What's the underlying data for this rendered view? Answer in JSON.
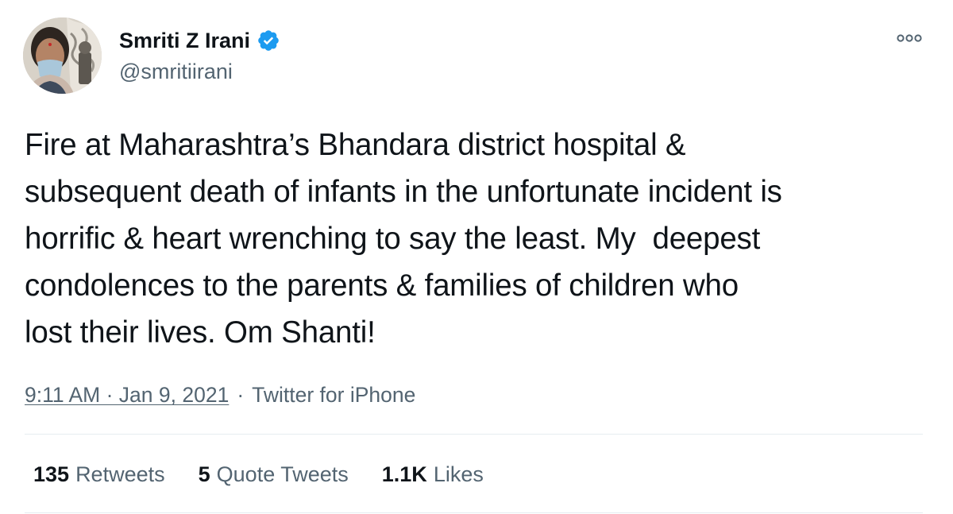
{
  "author": {
    "display_name": "Smriti Z Irani",
    "handle": "@smritiirani",
    "verified": true,
    "avatar_icon": "profile-photo"
  },
  "tweet": {
    "text": "Fire at Maharashtra’s Bhandara district hospital &\nsubsequent death of infants in the unfortunate incident is\nhorrific & heart wrenching to say the least. My  deepest\ncondolences to the parents & families of children who\nlost their lives. Om Shanti!",
    "timestamp": "9:11 AM · Jan 9, 2021",
    "separator": "·",
    "source": "Twitter for iPhone"
  },
  "stats": {
    "retweets": {
      "count": "135",
      "label": "Retweets"
    },
    "quote_tweets": {
      "count": "5",
      "label": "Quote Tweets"
    },
    "likes": {
      "count": "1.1K",
      "label": "Likes"
    }
  },
  "colors": {
    "verified_badge": "#1d9bf0",
    "text_primary": "#0f1419",
    "text_secondary": "#536471",
    "divider": "#e6ecf0"
  },
  "icons": {
    "verified": "verified-badge-icon",
    "more": "more-options-icon"
  }
}
